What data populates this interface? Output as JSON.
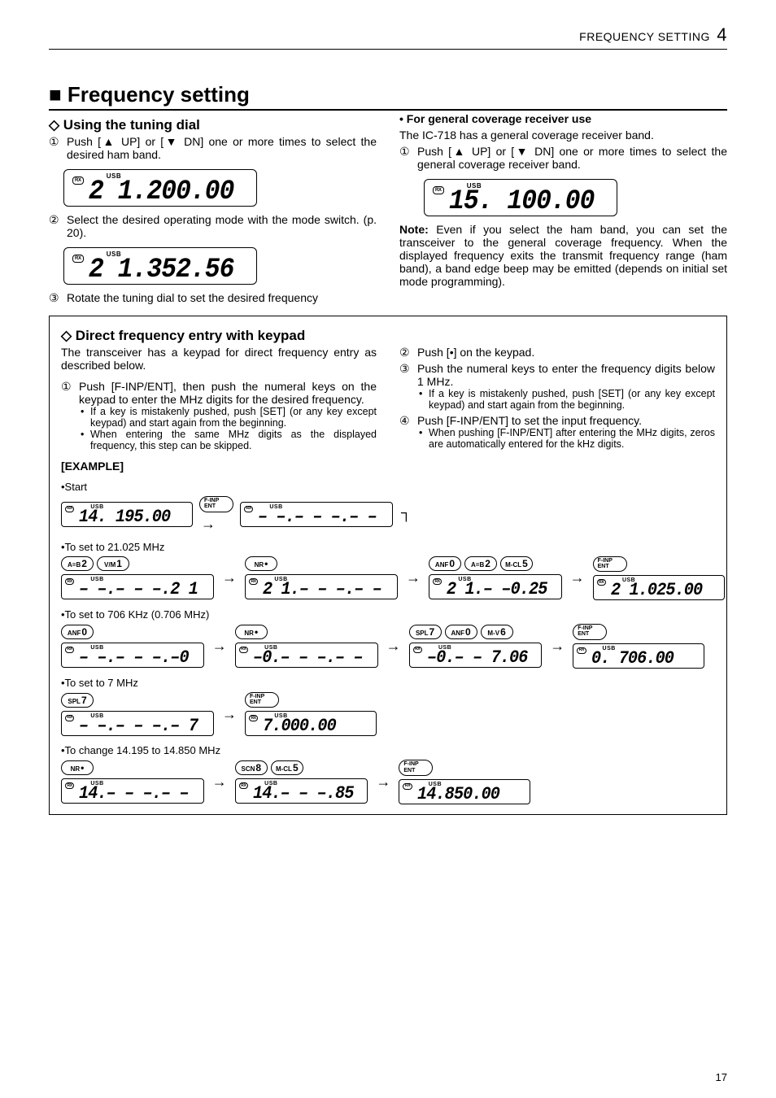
{
  "header": {
    "title": "FREQUENCY SETTING",
    "chapter": "4"
  },
  "section_title": "■ Frequency setting",
  "left": {
    "sub1": "Using the tuning dial",
    "step1": "Push [▲ UP] or [▼ DN] one or more times to select the desired ham band.",
    "lcd1_mode": "USB",
    "lcd1_freq": "2 1.200.00",
    "step2": "Select the desired operating mode with the mode switch. (p. 20).",
    "lcd2_mode": "USB",
    "lcd2_freq": "2 1.352.56",
    "step3": "Rotate the tuning dial to set the desired frequency"
  },
  "right": {
    "lead_bold": "• For general coverage receiver use",
    "lead_text": "The IC-718 has a general coverage receiver band.",
    "step1": "Push [▲ UP] or [▼ DN] one or more times to select the general coverage receiver band.",
    "lcd_mode": "USB",
    "lcd_freq": "15. 100.00",
    "note_lead": "Note:",
    "note": "Even if you select the ham band, you can set the transceiver to the general coverage frequency. When the displayed frequency exits the transmit frequency range (ham band), a band edge beep may be emitted (depends on initial set mode programming)."
  },
  "box": {
    "sub": "Direct frequency entry with keypad",
    "intro": "The transceiver has a keypad for direct frequency entry as described below.",
    "l1": "Push [F-INP/ENT], then push the numeral keys on the keypad to enter the MHz digits for the desired frequency.",
    "l1b1": "If a key is mistakenly pushed, push [SET] (or any key except keypad) and start again from the beginning.",
    "l1b2": "When entering the same MHz digits as the displayed frequency, this step can be skipped.",
    "r2": "Push [•] on the keypad.",
    "r3": "Push the numeral keys to enter the frequency digits below 1 MHz.",
    "r3b1": "If a key is mistakenly pushed, push [SET] (or any key except keypad) and start again from the beginning.",
    "r4": "Push [F-INP/ENT] to set the input frequency.",
    "r4b1": "When pushing [F-INP/ENT] after entering the MHz digits, zeros are automatically entered for the kHz digits.",
    "ex_label": "[EXAMPLE]",
    "rows": {
      "start": "•Start",
      "r1": "•To set to 21.025 MHz",
      "r2": "•To set to 706 KHz (0.706 MHz)",
      "r3": "•To set to 7 MHz",
      "r4": "•To change 14.195 to 14.850 MHz"
    },
    "lcd": {
      "start1": "14. 195.00",
      "start2": "– –.– – –.– –",
      "a1": "– –.– – –.2 1",
      "a2": "2 1.– – –.– –",
      "a3": "2 1.– –0.25",
      "a4": "2 1.025.00",
      "b1": "– –.– – –.–0",
      "b2": "–0.– – –.– –",
      "b3": "–0.– – 7.06",
      "b4": "0. 706.00",
      "c1": "– –.– – –.– 7",
      "c2": "7.000.00",
      "d1": "14.– – –.– –",
      "d2": "14.– – –.85",
      "d3": "14.850.00"
    },
    "keys": {
      "finp1": "F-INP",
      "finp2": "ENT",
      "a1a": "A=B",
      "a1b": "2",
      "a2a": "V/M",
      "a2b": "1",
      "nr": "NR",
      "nrb": "•",
      "anf": "ANF",
      "anfb": "0",
      "mcl": "M-CL",
      "mclb": "5",
      "spl": "SPL",
      "splb": "7",
      "mv": "M-V",
      "mvb": "6",
      "scn": "SCN",
      "scnb": "8"
    }
  },
  "page_num": "17",
  "rx_label": "RX"
}
